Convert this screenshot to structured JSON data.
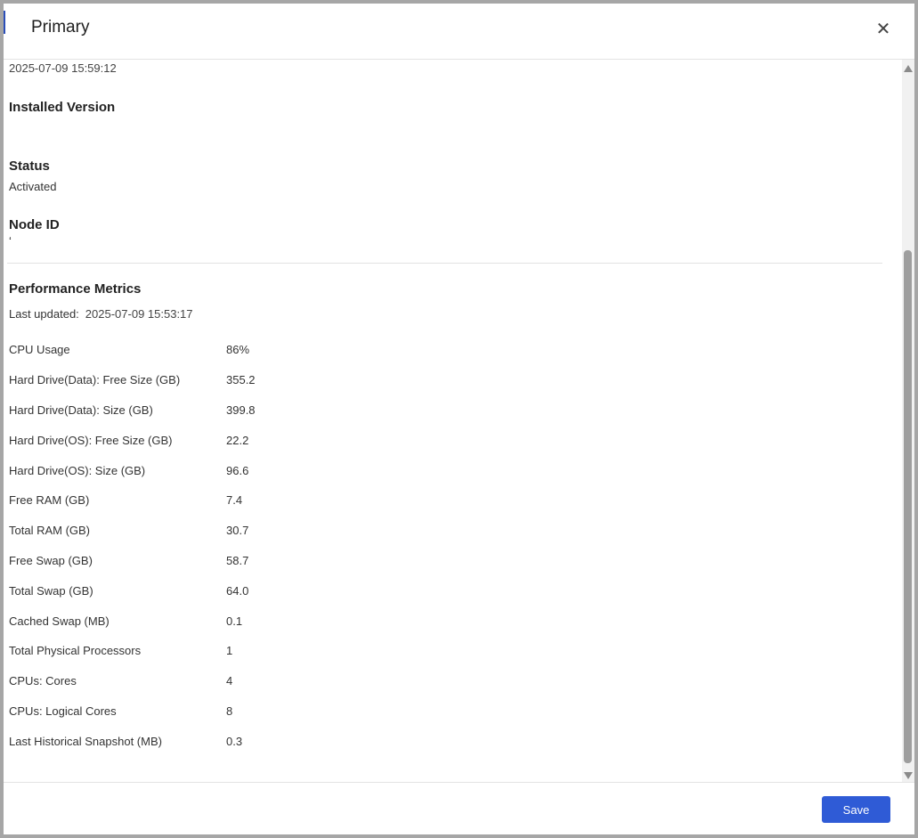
{
  "dialog": {
    "title": "Primary",
    "close_icon": "close-icon"
  },
  "details": {
    "timestamp": "2025-07-09 15:59:12",
    "installed_version_label": "Installed Version",
    "installed_version_value": "",
    "status_label": "Status",
    "status_value": "Activated",
    "node_id_label": "Node ID",
    "node_id_value": "‘"
  },
  "performance": {
    "title": "Performance Metrics",
    "last_updated_label": "Last updated:",
    "last_updated_value": "2025-07-09 15:53:17",
    "metrics": [
      {
        "label": "CPU Usage",
        "value": "86%"
      },
      {
        "label": "Hard Drive(Data): Free Size (GB)",
        "value": "355.2"
      },
      {
        "label": "Hard Drive(Data): Size (GB)",
        "value": "399.8"
      },
      {
        "label": "Hard Drive(OS): Free Size (GB)",
        "value": "22.2"
      },
      {
        "label": "Hard Drive(OS): Size (GB)",
        "value": "96.6"
      },
      {
        "label": "Free RAM (GB)",
        "value": "7.4"
      },
      {
        "label": "Total RAM (GB)",
        "value": "30.7"
      },
      {
        "label": "Free Swap (GB)",
        "value": "58.7"
      },
      {
        "label": "Total Swap (GB)",
        "value": "64.0"
      },
      {
        "label": "Cached Swap (MB)",
        "value": "0.1"
      },
      {
        "label": "Total Physical Processors",
        "value": "1"
      },
      {
        "label": "CPUs: Cores",
        "value": "4"
      },
      {
        "label": "CPUs: Logical Cores",
        "value": "8"
      },
      {
        "label": "Last Historical Snapshot (MB)",
        "value": "0.3"
      }
    ]
  },
  "footer": {
    "save_label": "Save"
  },
  "colors": {
    "primary_button": "#2f5bd6",
    "backdrop": "#a6a6a6"
  }
}
